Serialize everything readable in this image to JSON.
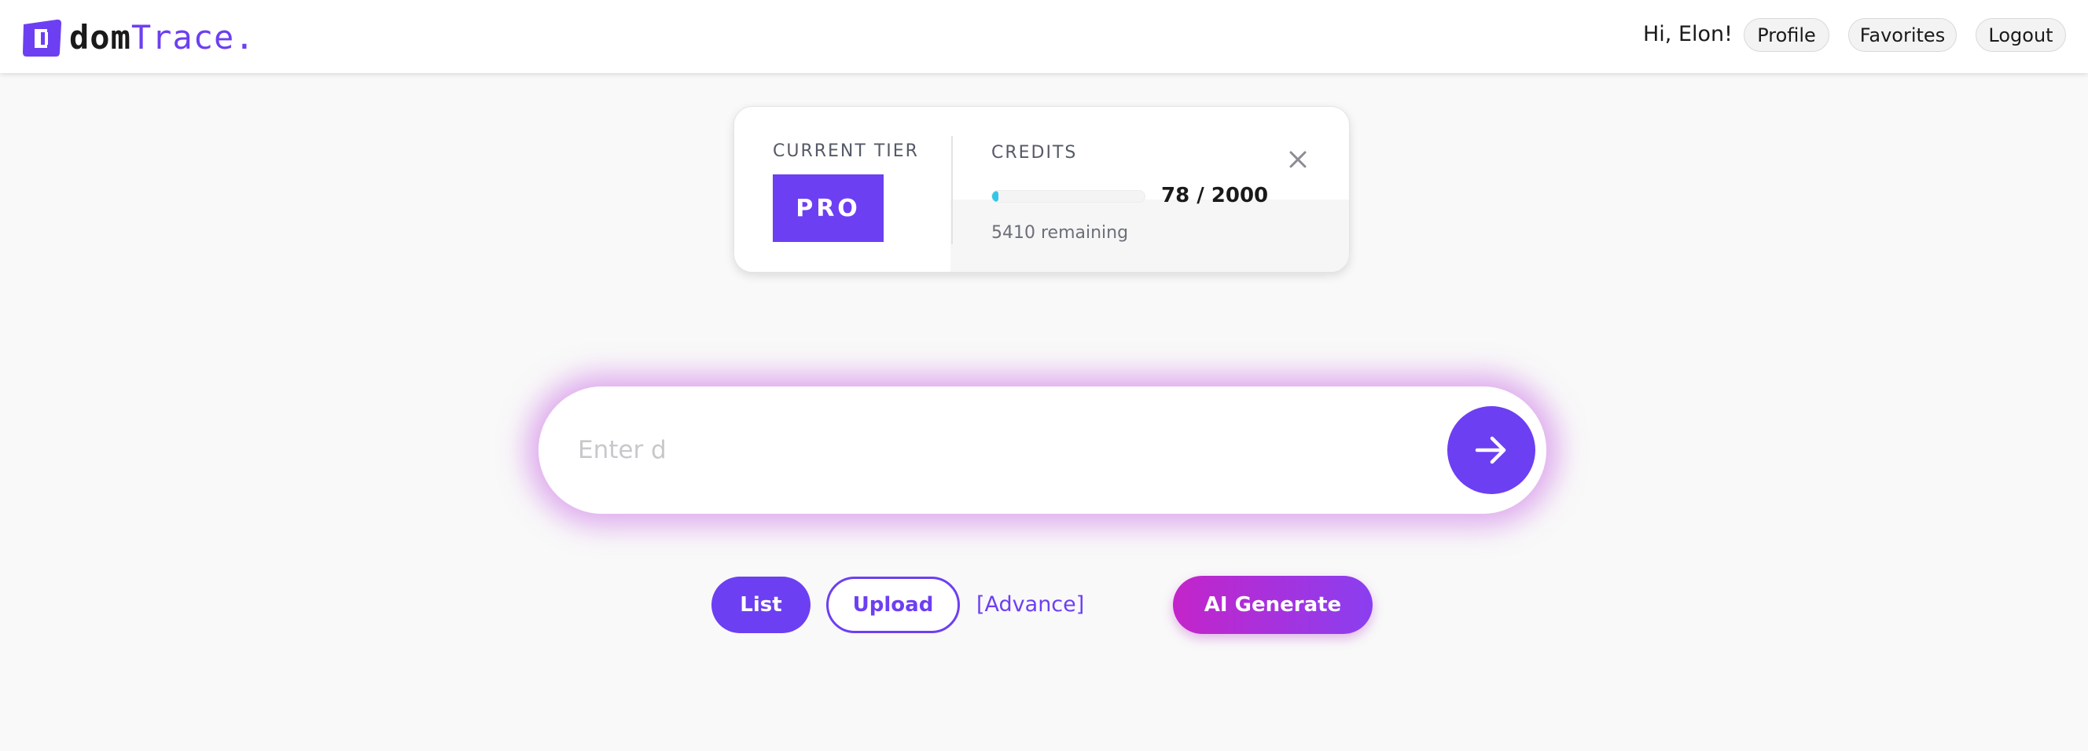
{
  "header": {
    "logo_text_dom": "dom",
    "logo_text_trace": "Trace.",
    "greeting": "Hi, Elon!",
    "nav": {
      "profile_label": "Profile",
      "favorites_label": "Favorites",
      "logout_label": "Logout"
    }
  },
  "tier_card": {
    "tier_label": "CURRENT TIER",
    "tier_value": "PRO",
    "credits_label": "CREDITS",
    "credits_used": 78,
    "credits_total": 2000,
    "credits_display": "78 / 2000",
    "remaining_text": "5410 remaining",
    "close_icon": "close-icon"
  },
  "search": {
    "placeholder": "Enter d",
    "value": "",
    "submit_icon": "arrow-right-icon"
  },
  "actions": {
    "list_label": "List",
    "upload_label": "Upload",
    "advance_label": "[Advance]",
    "ai_generate_label": "AI Generate"
  },
  "colors": {
    "accent": "#6d3ff2",
    "credit_bar": "#34c6e6",
    "ai_gradient_start": "#c424c9",
    "ai_gradient_end": "#8a3ff0",
    "search_glow": "#cb70e6",
    "page_background": "#f9f9f9"
  }
}
